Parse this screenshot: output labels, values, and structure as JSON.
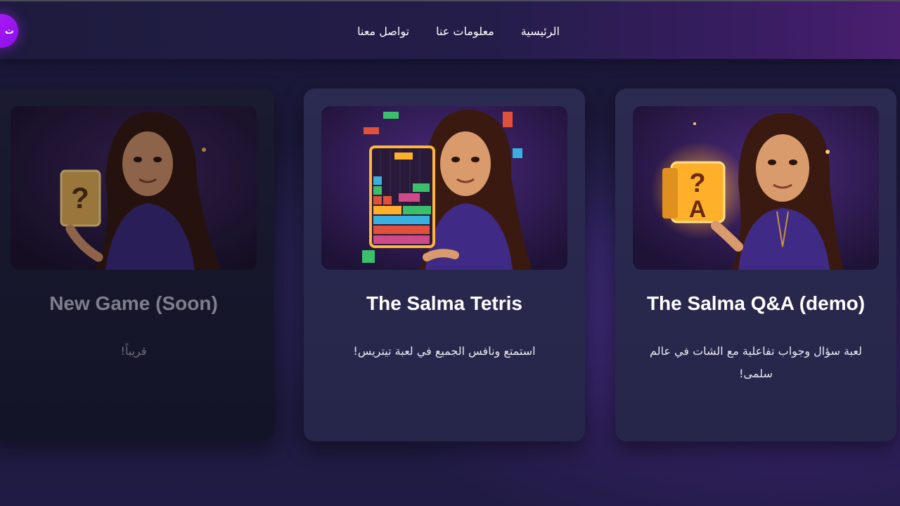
{
  "nav": {
    "side_button_label": "ت",
    "links": [
      "الرئيسية",
      "معلومات عنا",
      "تواصل معنا"
    ]
  },
  "cards": [
    {
      "title": "The Salma Q&A (demo)",
      "description": "لعبة سؤال وجواب تفاعلية مع الشات في عالم سلمى!",
      "image_icon": "question-cube-icon",
      "dimmed": false
    },
    {
      "title": "The Salma Tetris",
      "description": "استمتع ونافس الجميع في لعبة تيتريس!",
      "image_icon": "tetris-board-icon",
      "dimmed": false
    },
    {
      "title": "New Game (Soon)",
      "description": "قريباً!",
      "image_icon": "question-card-icon",
      "dimmed": true
    }
  ],
  "colors": {
    "accent": "#9d14f5",
    "card_bg": "#2b2b52",
    "page_bg": "#1c1a3c"
  }
}
